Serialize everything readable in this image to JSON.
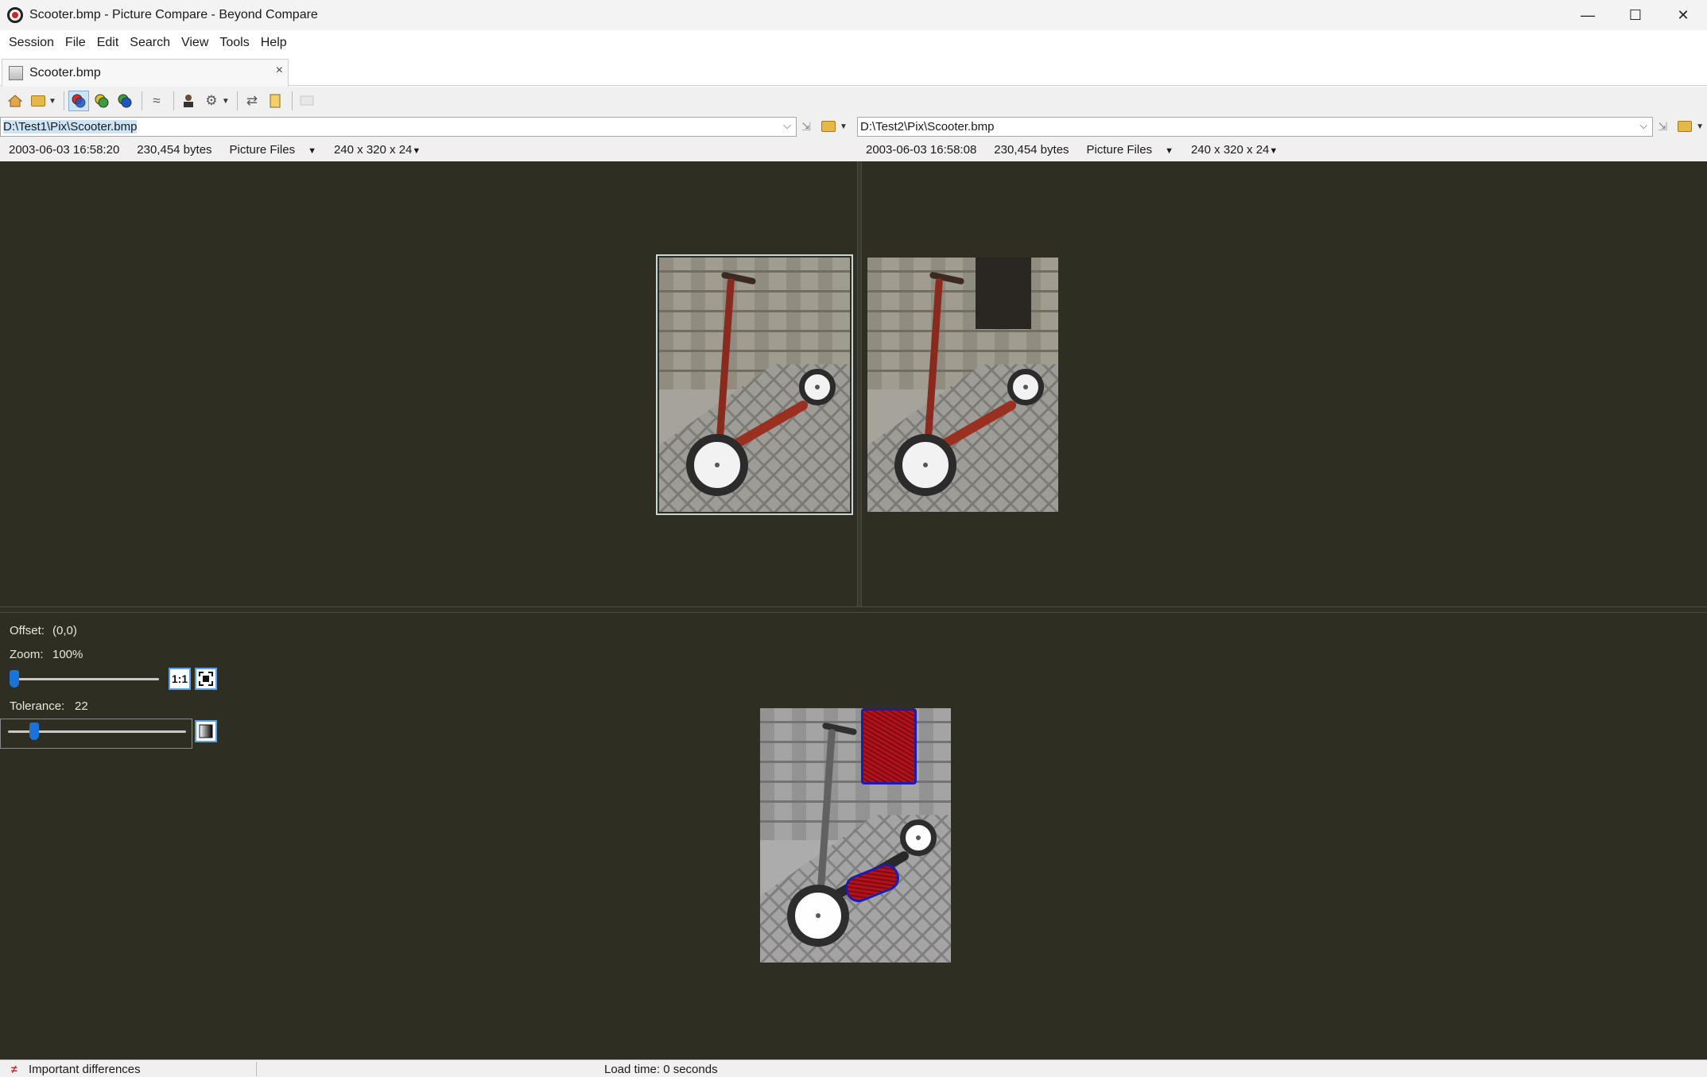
{
  "window": {
    "title": "Scooter.bmp - Picture Compare - Beyond Compare",
    "minimize": "—",
    "maximize": "☐",
    "close": "✕"
  },
  "menu": [
    {
      "label": "Session"
    },
    {
      "label": "File"
    },
    {
      "label": "Edit"
    },
    {
      "label": "Search"
    },
    {
      "label": "View"
    },
    {
      "label": "Tools"
    },
    {
      "label": "Help"
    }
  ],
  "tab": {
    "label": "Scooter.bmp",
    "close": "×"
  },
  "left": {
    "path": "D:\\Test1\\Pix\\Scooter.bmp",
    "timestamp": "2003-06-03 16:58:20",
    "size": "230,454 bytes",
    "filter": "Picture Files",
    "dimensions": "240 x 320 x 24"
  },
  "right": {
    "path": "D:\\Test2\\Pix\\Scooter.bmp",
    "timestamp": "2003-06-03 16:58:08",
    "size": "230,454 bytes",
    "filter": "Picture Files",
    "dimensions": "240 x 320 x 24"
  },
  "controls": {
    "offset_label": "Offset:",
    "offset_value": "(0,0)",
    "zoom_label": "Zoom:",
    "zoom_value": "100%",
    "zoom_level": 0.0,
    "one_to_one": "1:1",
    "tolerance_label": "Tolerance:",
    "tolerance_value": "22",
    "tolerance_level": 0.09
  },
  "status": {
    "diff_text": "Important differences",
    "load_time": "Load time: 0 seconds"
  },
  "colors": {
    "pane_bg": "#2e2e23",
    "diff_red": "#b3121a",
    "diff_outline": "#1b1bb0",
    "accent": "#1a73d9"
  }
}
